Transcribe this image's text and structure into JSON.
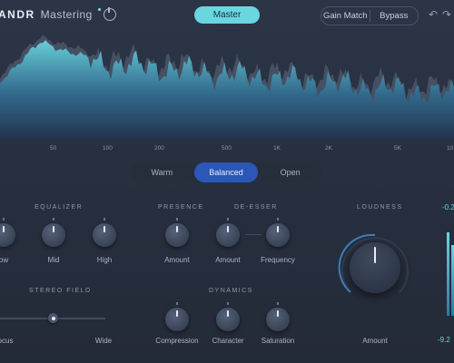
{
  "app": {
    "brand": "ANDR",
    "product": "Mastering"
  },
  "header": {
    "master_label": "Master",
    "gain_match_label": "Gain Match",
    "bypass_label": "Bypass",
    "undo_glyph": "↶",
    "redo_glyph": "↷"
  },
  "spectrum": {
    "frequency_labels": [
      "50",
      "100",
      "200",
      "500",
      "1K",
      "2K",
      "5K",
      "10"
    ],
    "colors": {
      "fill_top": "#6ad6df",
      "fill_bottom": "#1e3a5a",
      "shadow": "#4a5568"
    }
  },
  "profile": {
    "options": [
      "Warm",
      "Balanced",
      "Open"
    ],
    "selected": "Balanced"
  },
  "equalizer": {
    "title": "EQUALIZER",
    "knobs": [
      "Low",
      "Mid",
      "High"
    ],
    "low_visible_text": "ow"
  },
  "presence": {
    "title": "PRESENCE",
    "knob": "Amount"
  },
  "deesser": {
    "title": "DE-ESSER",
    "knobs": [
      "Amount",
      "Frequency"
    ]
  },
  "loudness": {
    "title": "LOUDNESS",
    "knob": "Amount",
    "meter_top": "-0.2",
    "meter_bottom": "-9.2"
  },
  "stereo_field": {
    "title": "STEREO FIELD",
    "left_label": "ocus",
    "right_label": "Wide",
    "position": 0.5
  },
  "dynamics": {
    "title": "DYNAMICS",
    "knobs": [
      "Compression",
      "Character",
      "Saturation"
    ]
  },
  "colors": {
    "accent": "#6ad6df",
    "selected_blue": "#2a57b8",
    "background": "#2a3343"
  }
}
